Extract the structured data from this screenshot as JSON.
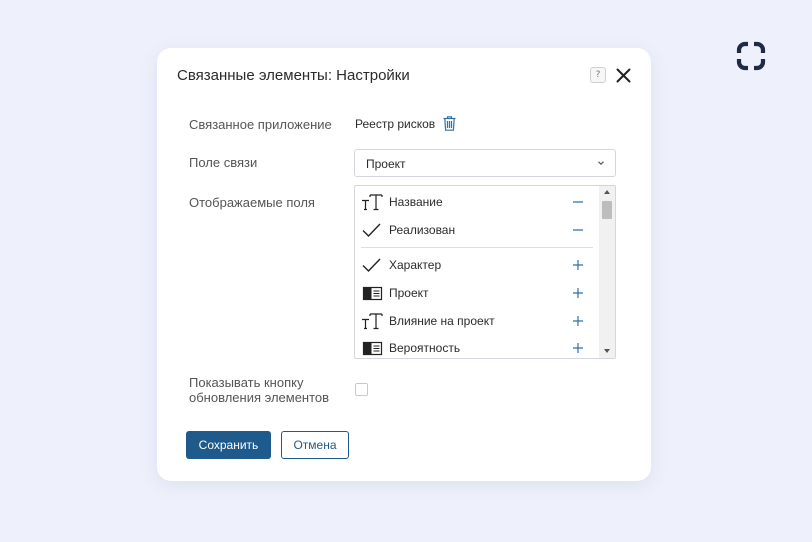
{
  "dialog": {
    "title": "Связанные элементы: Настройки",
    "help_label": "?"
  },
  "form": {
    "linked_app": {
      "label": "Связанное приложение",
      "value": "Реестр рисков"
    },
    "link_field": {
      "label": "Поле связи",
      "value": "Проект"
    },
    "display_fields": {
      "label": "Отображаемые поля",
      "selected": [
        {
          "label": "Название",
          "icon": "text-type-icon",
          "action": "remove"
        },
        {
          "label": "Реализован",
          "icon": "checkmark-icon",
          "action": "remove"
        }
      ],
      "available": [
        {
          "label": "Характер",
          "icon": "checkmark-icon",
          "action": "add"
        },
        {
          "label": "Проект",
          "icon": "app-link-icon",
          "action": "add"
        },
        {
          "label": "Влияние на проект",
          "icon": "text-type-icon",
          "action": "add"
        },
        {
          "label": "Вероятность",
          "icon": "app-link-icon",
          "action": "add"
        }
      ]
    },
    "refresh_button": {
      "label_line1": "Показывать кнопку",
      "label_line2": "обновления элементов",
      "checked": false
    }
  },
  "buttons": {
    "save": "Сохранить",
    "cancel": "Отмена"
  },
  "colors": {
    "background": "#eef1fb",
    "accent": "#1e5a8c",
    "action_icon": "#2f6fb0",
    "logo": "#1f2a44"
  }
}
